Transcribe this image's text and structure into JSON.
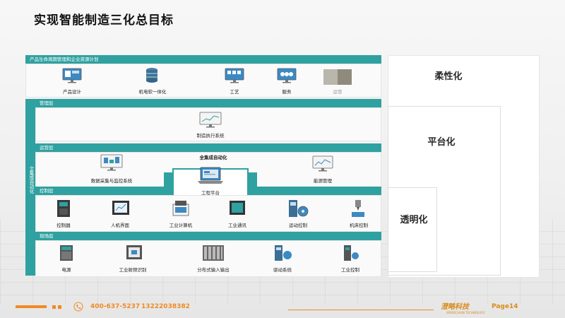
{
  "page": {
    "title": "实现智能制造三化总目标"
  },
  "layers": {
    "plm": {
      "label": "产品生命周期管理和企业资源计划",
      "items": [
        "产品设计",
        "机电软一体化",
        "工艺",
        "服务",
        "运营"
      ]
    },
    "management": {
      "label": "管理层",
      "items": [
        "制造执行系统"
      ]
    },
    "operations": {
      "label": "运营层",
      "items": [
        "数据采集与监控系统",
        "能源管理"
      ]
    },
    "integration": {
      "label": "全集成自动化",
      "platform": "工程平台"
    },
    "control": {
      "label": "控制层",
      "items": [
        "控制器",
        "人机界面",
        "工业计算机",
        "工业通讯",
        "运动控制",
        "机床控制"
      ]
    },
    "field": {
      "label": "现场层",
      "items": [
        "电源",
        "工业射频识别",
        "分布式输入输出",
        "驱动系统",
        "工业控制"
      ]
    },
    "side_label": "全集成自动化"
  },
  "goals": [
    "柔性化",
    "平台化",
    "透明化"
  ],
  "footer": {
    "phone": "400-637-5237",
    "mobile": "13222038382",
    "page": "Page14",
    "logo": "澄略科技",
    "logo_sub": "SPEEDCHAIN TECHNOLOGY"
  },
  "colors": {
    "accent": "#2fa1a0",
    "orange": "#f08a24"
  }
}
